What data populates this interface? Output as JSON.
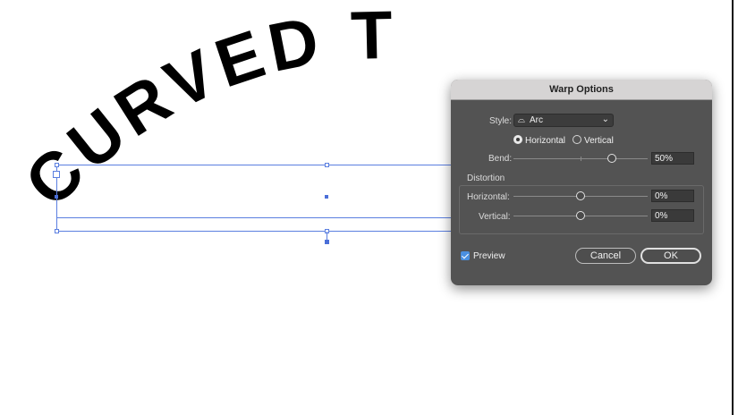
{
  "canvas": {
    "curved_text": "CURVED T"
  },
  "dialog": {
    "title": "Warp Options",
    "style_label": "Style:",
    "style_value": "Arc",
    "orientation_horizontal": "Horizontal",
    "orientation_vertical": "Vertical",
    "orientation_selected": "Horizontal",
    "bend_label": "Bend:",
    "bend_value": "50%",
    "bend_fraction": 0.75,
    "distortion_label": "Distortion",
    "horizontal_label": "Horizontal:",
    "horizontal_value": "0%",
    "vertical_label": "Vertical:",
    "vertical_value": "0%",
    "preview_label": "Preview",
    "preview_checked": true,
    "cancel_label": "Cancel",
    "ok_label": "OK"
  },
  "colors": {
    "selection": "#5b7fe0",
    "dialog_bg": "#535353",
    "checkbox": "#4a8fe0"
  },
  "icons": {
    "style": "arc-warp-icon",
    "dropdown": "chevron-down-icon"
  }
}
